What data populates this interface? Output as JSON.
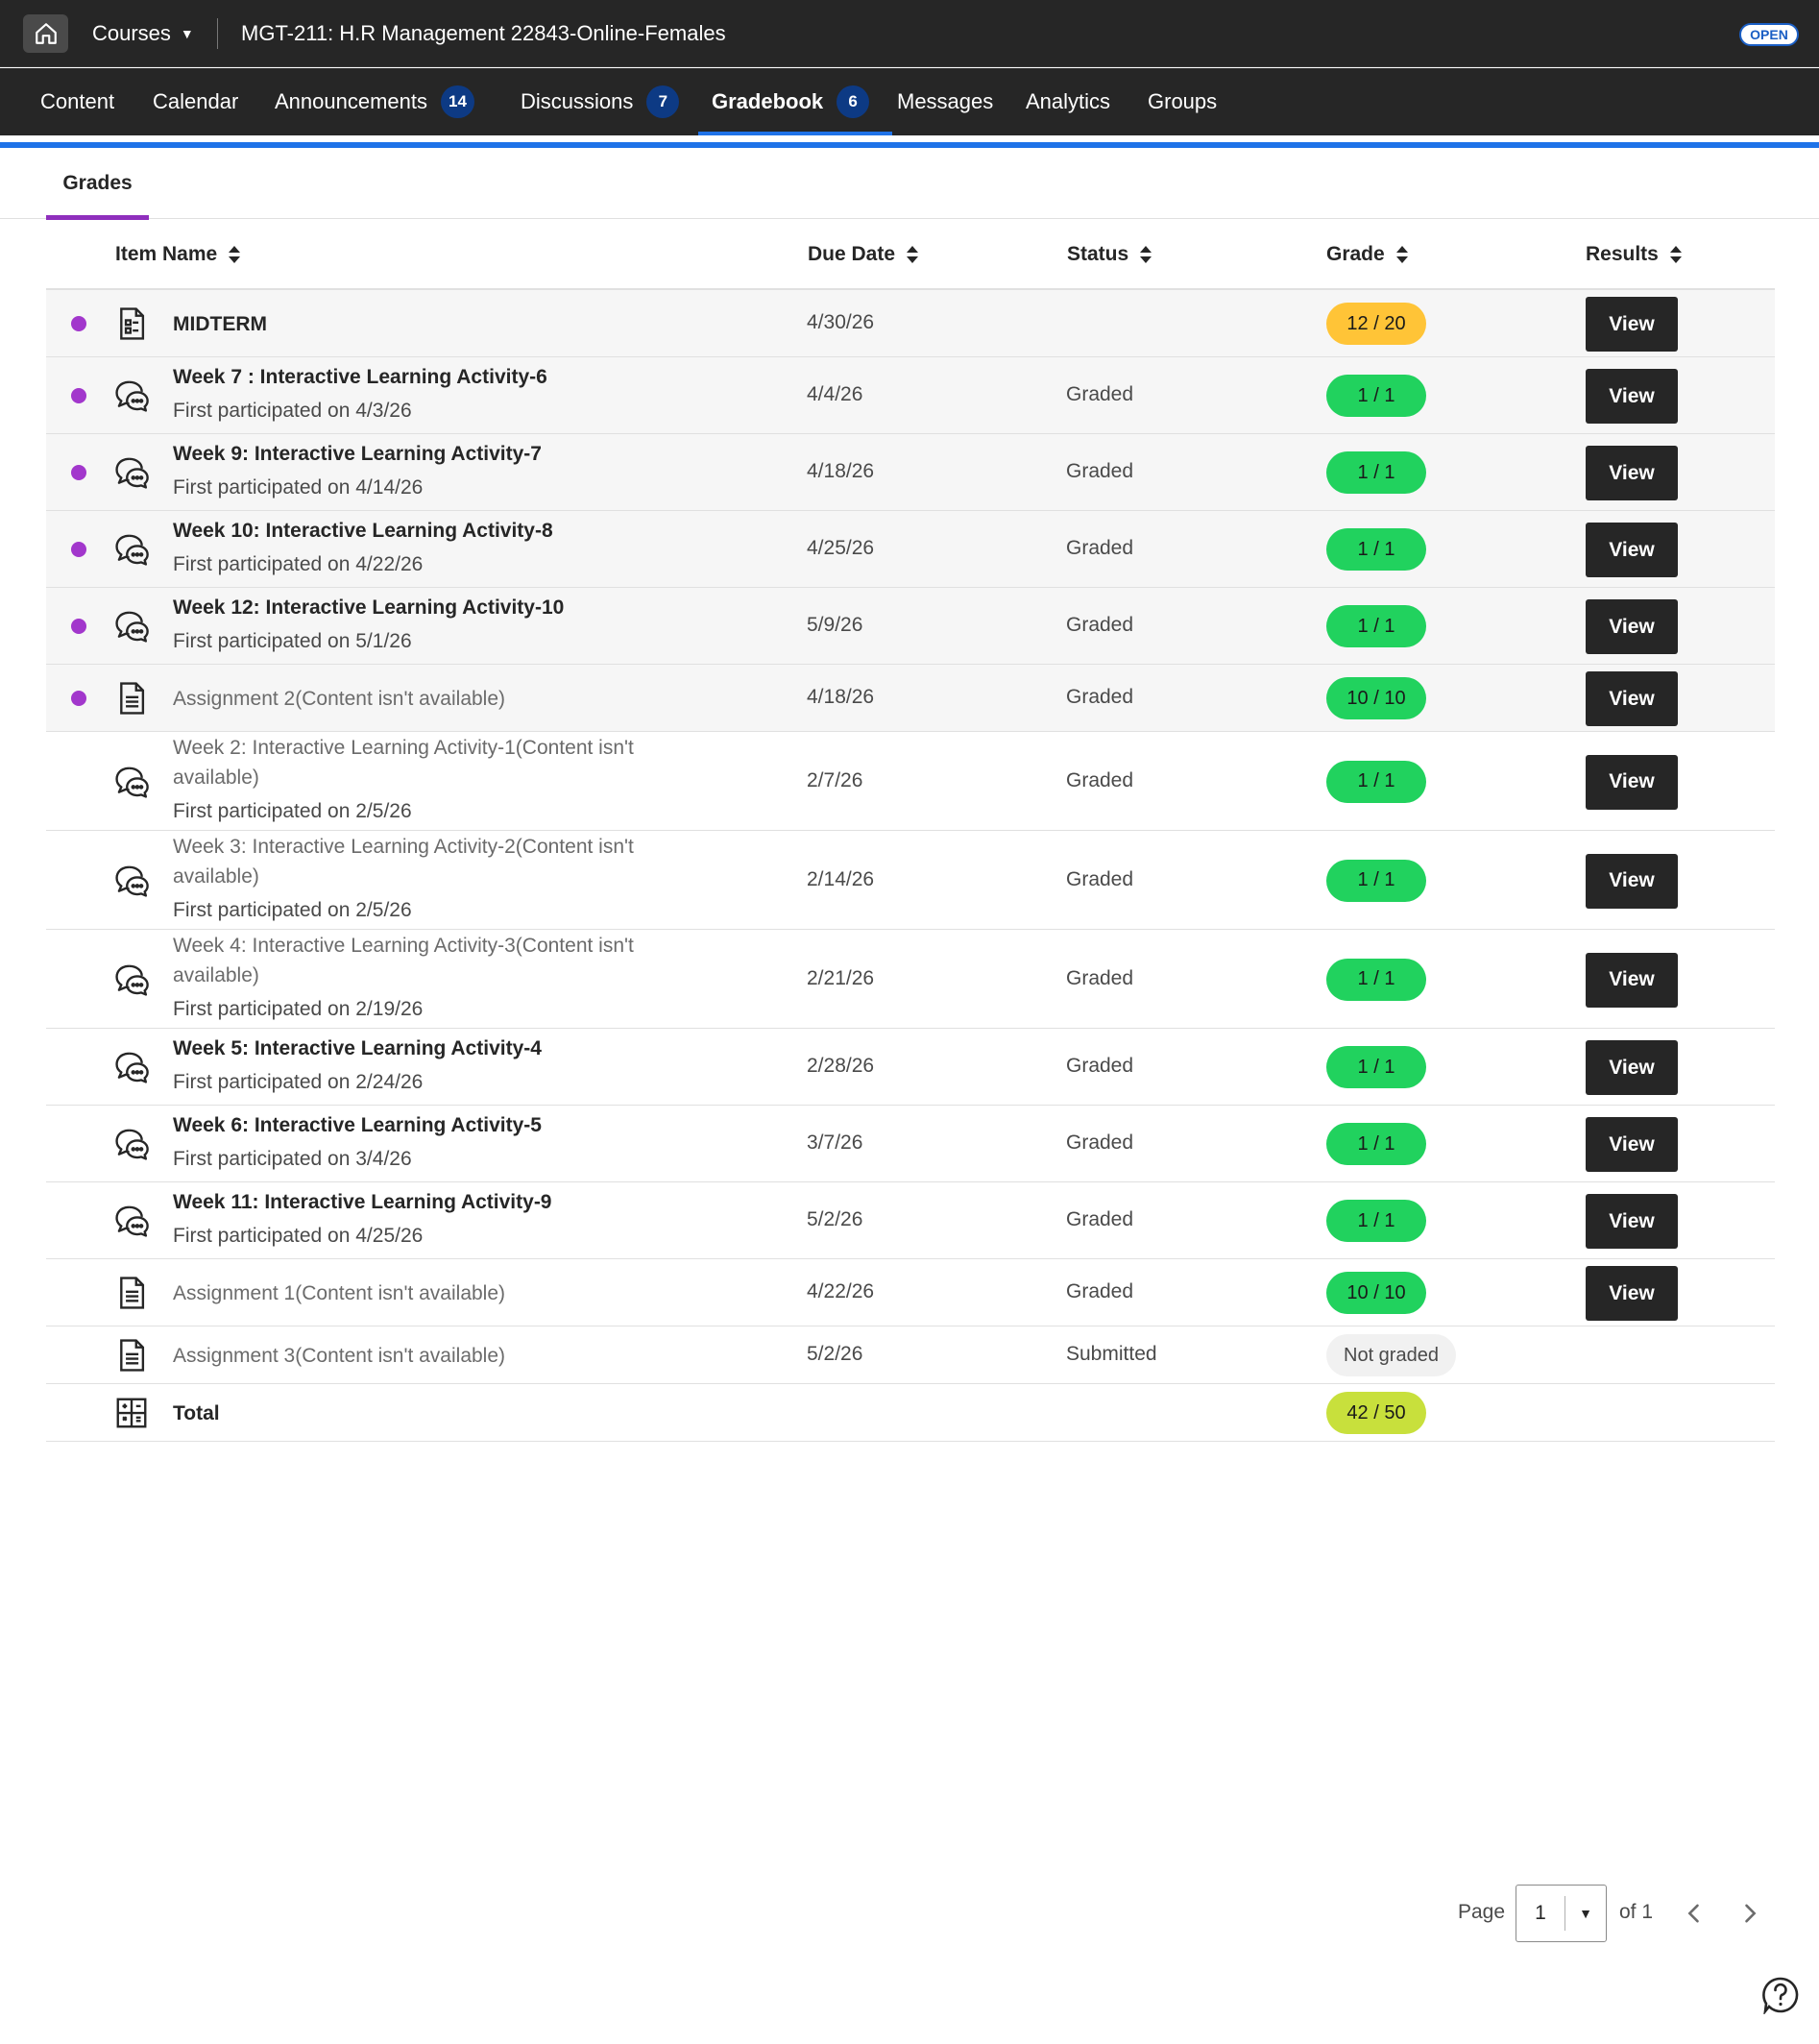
{
  "topbar": {
    "courses_label": "Courses",
    "course_title": "MGT-211: H.R Management 22843-Online-Females",
    "status_badge": "OPEN"
  },
  "nav": {
    "tabs": [
      {
        "label": "Content",
        "count": ""
      },
      {
        "label": "Calendar",
        "count": ""
      },
      {
        "label": "Announcements",
        "count": "14"
      },
      {
        "label": "Discussions",
        "count": "7"
      },
      {
        "label": "Gradebook",
        "count": "6"
      },
      {
        "label": "Messages",
        "count": ""
      },
      {
        "label": "Analytics",
        "count": ""
      },
      {
        "label": "Groups",
        "count": ""
      }
    ],
    "active_tab": "Gradebook"
  },
  "subtab": {
    "label": "Grades"
  },
  "table": {
    "headers": [
      "Item Name",
      "Due Date",
      "Status",
      "Grade",
      "Results"
    ],
    "rows": [
      {
        "icon": "test-icon",
        "new": true,
        "name": "MIDTERM",
        "available": true,
        "sub": "",
        "due": "4/30/26",
        "status": "",
        "grade": "12 / 20",
        "grade_color": "#ffc437",
        "view": "View"
      },
      {
        "icon": "discussion-icon",
        "new": true,
        "name": "Week 7 : Interactive Learning Activity-6",
        "available": true,
        "sub": "First participated on 4/3/26",
        "due": "4/4/26",
        "status": "Graded",
        "grade": "1 / 1",
        "grade_color": "#21d25e",
        "view": "View"
      },
      {
        "icon": "discussion-icon",
        "new": true,
        "name": "Week 9: Interactive Learning Activity-7",
        "available": true,
        "sub": "First participated on 4/14/26",
        "due": "4/18/26",
        "status": "Graded",
        "grade": "1 / 1",
        "grade_color": "#21d25e",
        "view": "View"
      },
      {
        "icon": "discussion-icon",
        "new": true,
        "name": "Week 10: Interactive Learning Activity-8",
        "available": true,
        "sub": "First participated on 4/22/26",
        "due": "4/25/26",
        "status": "Graded",
        "grade": "1 / 1",
        "grade_color": "#21d25e",
        "view": "View"
      },
      {
        "icon": "discussion-icon",
        "new": true,
        "name": "Week 12: Interactive Learning Activity-10",
        "available": true,
        "sub": "First participated on 5/1/26",
        "due": "5/9/26",
        "status": "Graded",
        "grade": "1 / 1",
        "grade_color": "#21d25e",
        "view": "View"
      },
      {
        "icon": "assignment-icon",
        "new": true,
        "name": "Assignment 2(Content isn't available)",
        "available": false,
        "sub": "",
        "due": "4/18/26",
        "status": "Graded",
        "grade": "10 / 10",
        "grade_color": "#21d25e",
        "view": "View"
      },
      {
        "icon": "discussion-icon",
        "new": false,
        "name": "Week 2: Interactive Learning Activity-1(Content isn't available)",
        "available": false,
        "sub": "First participated on 2/5/26",
        "due": "2/7/26",
        "status": "Graded",
        "grade": "1 / 1",
        "grade_color": "#21d25e",
        "view": "View"
      },
      {
        "icon": "discussion-icon",
        "new": false,
        "name": "Week 3: Interactive Learning Activity-2(Content isn't available)",
        "available": false,
        "sub": "First participated on 2/5/26",
        "due": "2/14/26",
        "status": "Graded",
        "grade": "1 / 1",
        "grade_color": "#21d25e",
        "view": "View"
      },
      {
        "icon": "discussion-icon",
        "new": false,
        "name": "Week 4: Interactive Learning  Activity-3(Content isn't available)",
        "available": false,
        "sub": "First participated on 2/19/26",
        "due": "2/21/26",
        "status": "Graded",
        "grade": "1 / 1",
        "grade_color": "#21d25e",
        "view": "View"
      },
      {
        "icon": "discussion-icon",
        "new": false,
        "name": "Week 5: Interactive Learning Activity-4",
        "available": true,
        "sub": "First participated on 2/24/26",
        "due": "2/28/26",
        "status": "Graded",
        "grade": "1 / 1",
        "grade_color": "#21d25e",
        "view": "View"
      },
      {
        "icon": "discussion-icon",
        "new": false,
        "name": "Week 6: Interactive Learning Activity-5",
        "available": true,
        "sub": "First participated on 3/4/26",
        "due": "3/7/26",
        "status": "Graded",
        "grade": "1 / 1",
        "grade_color": "#21d25e",
        "view": "View"
      },
      {
        "icon": "discussion-icon",
        "new": false,
        "name": "Week 11: Interactive Learning Activity-9",
        "available": true,
        "sub": "First participated on 4/25/26",
        "due": "5/2/26",
        "status": "Graded",
        "grade": "1 / 1",
        "grade_color": "#21d25e",
        "view": "View"
      },
      {
        "icon": "assignment-icon",
        "new": false,
        "name": "Assignment 1(Content isn't available)",
        "available": false,
        "sub": "",
        "due": "4/22/26",
        "status": "Graded",
        "grade": "10 / 10",
        "grade_color": "#21d25e",
        "view": "View"
      },
      {
        "icon": "assignment-icon",
        "new": false,
        "name": "Assignment 3(Content isn't available)",
        "available": false,
        "sub": "",
        "due": "5/2/26",
        "status": "Submitted",
        "grade": "Not graded",
        "grade_color": "#f1f1f1",
        "view": ""
      },
      {
        "icon": "calculator-icon",
        "new": false,
        "name": "Total",
        "available": true,
        "sub": "",
        "due": "",
        "status": "",
        "grade": "42 / 50",
        "grade_color": "#c8e03c",
        "view": ""
      }
    ]
  },
  "pager": {
    "page_label": "Page",
    "current": "1",
    "of_label": "of 1"
  },
  "icons": {
    "home": "home-icon",
    "prev": "chevron-left-icon",
    "next": "chevron-right-icon",
    "help": "help-icon"
  }
}
